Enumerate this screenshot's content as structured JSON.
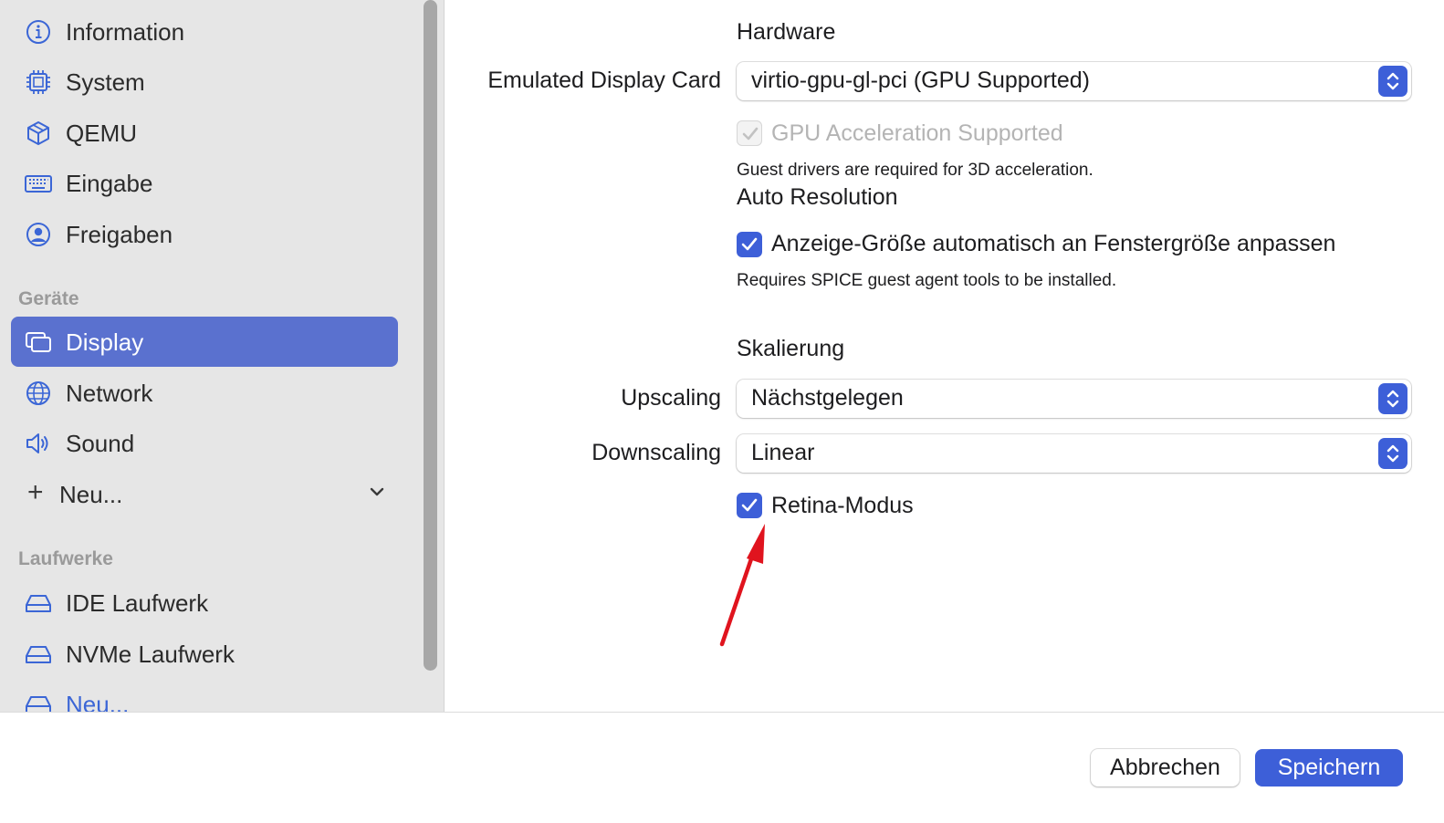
{
  "sidebar": {
    "items": [
      {
        "label": "Information",
        "icon": "info-circle-icon"
      },
      {
        "label": "System",
        "icon": "cpu-chip-icon"
      },
      {
        "label": "QEMU",
        "icon": "cube-icon"
      },
      {
        "label": "Eingabe",
        "icon": "keyboard-icon"
      },
      {
        "label": "Freigaben",
        "icon": "person-circle-icon"
      }
    ],
    "devices_heading": "Geräte",
    "devices": [
      {
        "label": "Display",
        "icon": "display-windows-icon",
        "selected": true
      },
      {
        "label": "Network",
        "icon": "globe-icon"
      },
      {
        "label": "Sound",
        "icon": "speaker-icon"
      }
    ],
    "add_device": "Neu...",
    "drives_heading": "Laufwerke",
    "drives": [
      {
        "label": "IDE Laufwerk",
        "icon": "drive-icon"
      },
      {
        "label": "NVMe Laufwerk",
        "icon": "drive-icon"
      },
      {
        "label": "Neu...",
        "icon": "drive-add-icon"
      }
    ]
  },
  "form": {
    "hardware_heading": "Hardware",
    "display_card_label": "Emulated Display Card",
    "display_card_value": "virtio-gpu-gl-pci (GPU Supported)",
    "gpu_accel_label": "GPU Acceleration Supported",
    "gpu_accel_checked": true,
    "gpu_accel_disabled": true,
    "gpu_note": "Guest drivers are required for 3D acceleration.",
    "auto_res_heading": "Auto Resolution",
    "auto_resize_label": "Anzeige-Größe automatisch an Fenstergröße anpassen",
    "auto_resize_checked": true,
    "spice_note": "Requires SPICE guest agent tools to be installed.",
    "scaling_heading": "Skalierung",
    "upscaling_label": "Upscaling",
    "upscaling_value": "Nächstgelegen",
    "downscaling_label": "Downscaling",
    "downscaling_value": "Linear",
    "retina_label": "Retina-Modus",
    "retina_checked": true
  },
  "footer": {
    "cancel_label": "Abbrechen",
    "save_label": "Speichern"
  },
  "colors": {
    "accent": "#3d5fd8",
    "selection": "#5a71cf",
    "sidebar_bg": "#e6e6e6",
    "annotation_arrow": "#e0141e"
  }
}
